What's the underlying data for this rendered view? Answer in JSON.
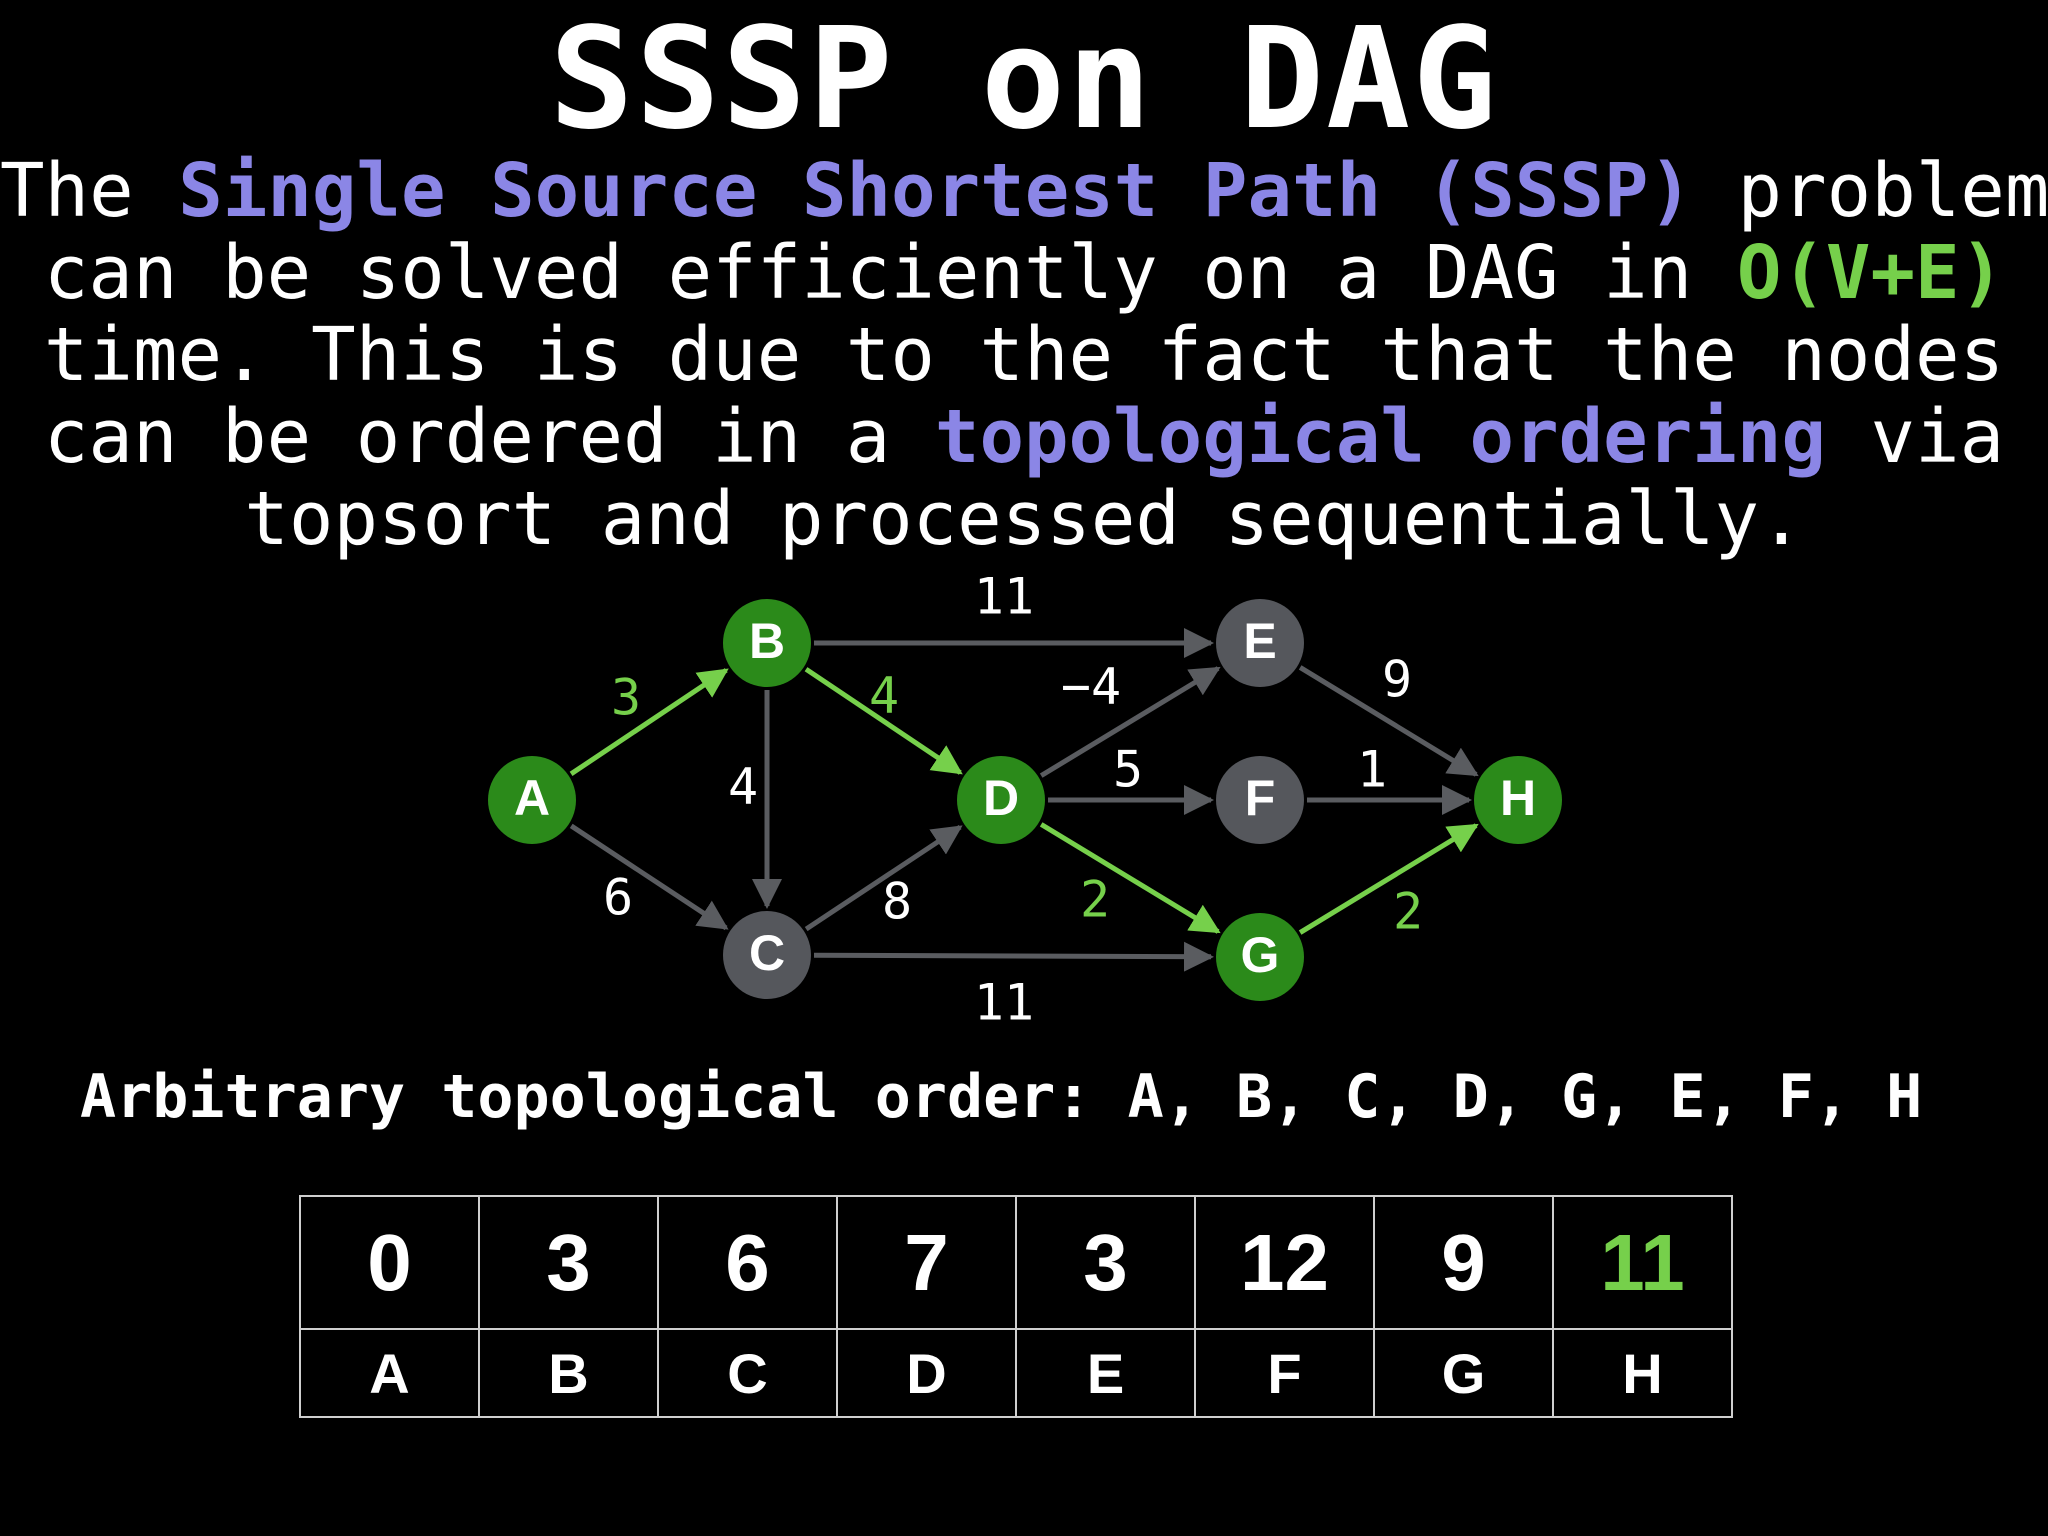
{
  "title": "SSSP on DAG",
  "description": {
    "l1": [
      "The ",
      "Single Source Shortest Path (SSSP)",
      " problem"
    ],
    "l2": [
      "can be solved efficiently on a DAG in ",
      "O(V+E)"
    ],
    "l3": "time. This is due to the fact that the nodes",
    "l4": [
      "can be ordered in a ",
      "topological ordering",
      " via"
    ],
    "l5": "topsort and processed sequentially."
  },
  "graph": {
    "nodes": [
      {
        "id": "A",
        "state": "visited"
      },
      {
        "id": "B",
        "state": "visited"
      },
      {
        "id": "C",
        "state": "default"
      },
      {
        "id": "D",
        "state": "visited"
      },
      {
        "id": "E",
        "state": "default"
      },
      {
        "id": "F",
        "state": "default"
      },
      {
        "id": "G",
        "state": "visited"
      },
      {
        "id": "H",
        "state": "visited"
      }
    ],
    "edges": [
      {
        "from": "A",
        "to": "B",
        "weight": "3",
        "highlighted": true
      },
      {
        "from": "A",
        "to": "C",
        "weight": "6",
        "highlighted": false
      },
      {
        "from": "B",
        "to": "C",
        "weight": "4",
        "highlighted": false
      },
      {
        "from": "B",
        "to": "D",
        "weight": "4",
        "highlighted": true
      },
      {
        "from": "B",
        "to": "E",
        "weight": "11",
        "highlighted": false
      },
      {
        "from": "C",
        "to": "D",
        "weight": "8",
        "highlighted": false
      },
      {
        "from": "C",
        "to": "G",
        "weight": "11",
        "highlighted": false
      },
      {
        "from": "D",
        "to": "E",
        "weight": "−4",
        "highlighted": false
      },
      {
        "from": "D",
        "to": "F",
        "weight": "5",
        "highlighted": false
      },
      {
        "from": "D",
        "to": "G",
        "weight": "2",
        "highlighted": true
      },
      {
        "from": "E",
        "to": "H",
        "weight": "9",
        "highlighted": false
      },
      {
        "from": "F",
        "to": "H",
        "weight": "1",
        "highlighted": false
      },
      {
        "from": "G",
        "to": "H",
        "weight": "2",
        "highlighted": true
      }
    ]
  },
  "topological_order": "Arbitrary topological order: A, B, C, D, G, E, F, H",
  "distance_table": {
    "values": [
      "0",
      "3",
      "6",
      "7",
      "3",
      "12",
      "9",
      "11"
    ],
    "labels": [
      "A",
      "B",
      "C",
      "D",
      "E",
      "F",
      "G",
      "H"
    ],
    "highlight_index": 7
  },
  "colors": {
    "background": "#000000",
    "text": "#ffffff",
    "purple_highlight": "#8b86e6",
    "green_highlight": "#76d04b",
    "node_visited": "#2b8a1a",
    "node_default": "#55575c",
    "edge_default": "#5a5c60",
    "edge_highlight": "#76d04b"
  }
}
